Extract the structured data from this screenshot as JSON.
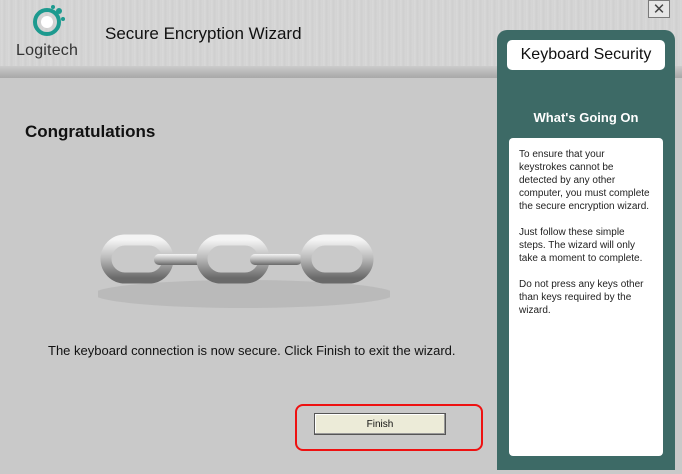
{
  "header": {
    "brand": "Logitech",
    "title": "Secure Encryption Wizard"
  },
  "close_icon": "close-icon",
  "right_panel": {
    "title": "Keyboard Security",
    "section_heading": "What's Going On",
    "paragraphs": [
      "To ensure that your keystrokes cannot be detected by any other computer, you must complete the secure encryption wizard.",
      "Just follow these simple steps. The wizard will only take a moment to complete.",
      "Do not press any keys other than keys required by the wizard."
    ]
  },
  "main": {
    "heading": "Congratulations",
    "illustration": "chain-links-icon",
    "message": "The keyboard connection is now secure. Click Finish to exit the wizard.",
    "finish_label": "Finish"
  },
  "colors": {
    "panel": "#3d6a66",
    "highlight": "#e11111"
  }
}
